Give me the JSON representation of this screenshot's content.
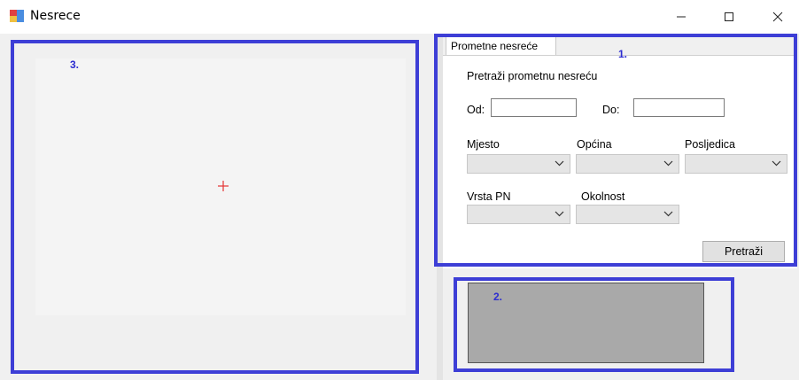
{
  "window": {
    "title": "Nesrece"
  },
  "canvas": {
    "marker": "3."
  },
  "tab": {
    "label": "Prometne nesreće",
    "marker": "1.",
    "section_title": "Pretraži prometnu nesreću",
    "from_label": "Od:",
    "from_value": "",
    "to_label": "Do:",
    "to_value": "",
    "place_label": "Mjesto",
    "municipality_label": "Općina",
    "consequence_label": "Posljedica",
    "type_label": "Vrsta PN",
    "circumstance_label": "Okolnost",
    "search_button": "Pretraži"
  },
  "result_panel": {
    "marker": "2."
  },
  "colors": {
    "highlight": "#3d3ed6",
    "crosshair": "#e53333",
    "panel_gray": "#a9a9a9"
  }
}
